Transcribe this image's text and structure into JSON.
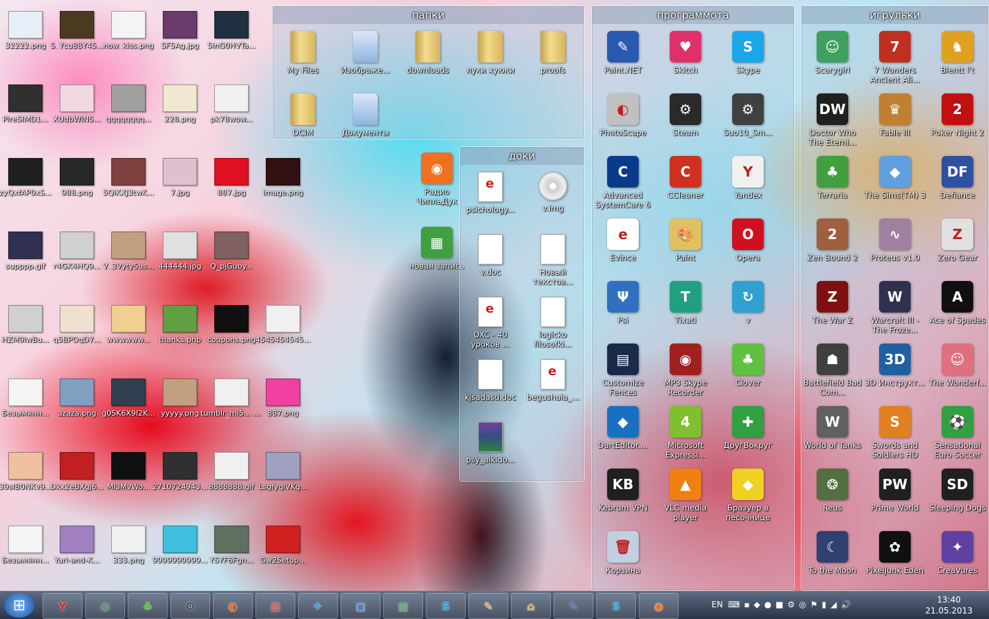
{
  "desktop_icons": [
    {
      "label": "32222.png",
      "color": "#e8eef8"
    },
    {
      "label": "S_Ycu88Y45...",
      "color": "#4a3a20"
    },
    {
      "label": "now_kiss.png",
      "color": "#f4f4f4"
    },
    {
      "label": "SF5Ag.jpg",
      "color": "#6a3a6a"
    },
    {
      "label": "5inG0HVTa...",
      "color": "#203040"
    },
    {
      "label": "PireSIMD1...",
      "color": "#303030"
    },
    {
      "label": "XUdbWIN5...",
      "color": "#f0d8e0"
    },
    {
      "label": "qqqqqqqq...",
      "color": "#a0a0a0"
    },
    {
      "label": "228.png",
      "color": "#f0e8d0"
    },
    {
      "label": "pk78wow...",
      "color": "#f0f0f0"
    },
    {
      "label": "zyQxfAP0xS...",
      "color": "#202020"
    },
    {
      "label": "988.png",
      "color": "#282828"
    },
    {
      "label": "5QiKXJ3twK...",
      "color": "#804040"
    },
    {
      "label": "7.jpg",
      "color": "#e0c0d0"
    },
    {
      "label": "887.jpg",
      "color": "#e01020"
    },
    {
      "label": "image.png",
      "color": "#301010"
    },
    {
      "label": "supppp.gif",
      "color": "#303050"
    },
    {
      "label": "r4GK4HQ9...",
      "color": "#d0d0d0"
    },
    {
      "label": "V_3Vyty5us...",
      "color": "#c0a080"
    },
    {
      "label": "444444.jpg",
      "color": "#e0e0e0"
    },
    {
      "label": "Q_pjGuby...",
      "color": "#806060"
    },
    {
      "label": "HZM9lwBu...",
      "color": "#d0d0d0"
    },
    {
      "label": "q5BPOqD7...",
      "color": "#f0e0d0"
    },
    {
      "label": "wwwwww...",
      "color": "#f0d090"
    },
    {
      "label": "thanks.php",
      "color": "#60a040"
    },
    {
      "label": "coupons.png",
      "color": "#101010"
    },
    {
      "label": "4545454545...",
      "color": "#f0f0f0"
    },
    {
      "label": "Безымянн...",
      "color": "#f4f4f4"
    },
    {
      "label": "azaza.png",
      "color": "#80a0c0"
    },
    {
      "label": "g0SK6X9I2K...",
      "color": "#304050"
    },
    {
      "label": "yyyyy.png",
      "color": "#c0a080"
    },
    {
      "label": "tumblr_mi5... (1).jpg",
      "color": "#f0f0f0"
    },
    {
      "label": "887.png",
      "color": "#f040a0"
    },
    {
      "label": "39sIB0NKv9...",
      "color": "#f0c0a0"
    },
    {
      "label": "Dkx2eBXgj6...",
      "color": "#c02020"
    },
    {
      "label": "Mi3MvWo...",
      "color": "#101010"
    },
    {
      "label": "2710724943...",
      "color": "#303030"
    },
    {
      "label": "8888888.gif",
      "color": "#f0f0f0"
    },
    {
      "label": "LsgfyqiVKg...",
      "color": "#a0a0c0"
    },
    {
      "label": "Безымянн...",
      "color": "#f4f4f4"
    },
    {
      "label": "Yuri-and-K...",
      "color": "#a080c0"
    },
    {
      "label": "333.png",
      "color": "#f0f0f0"
    },
    {
      "label": "9999999999...",
      "color": "#40c0e0"
    },
    {
      "label": "YSYF6Fgn...",
      "color": "#607060"
    },
    {
      "label": "Gw2Setup...",
      "color": "#d02020"
    }
  ],
  "loose_icons": [
    {
      "label": "Радио ЧипльДук",
      "color": "#f07020"
    },
    {
      "label": "новая запись",
      "color": "#40a040"
    }
  ],
  "fences": {
    "folders": {
      "title": "папки",
      "items": [
        {
          "label": "My Files",
          "kind": "folder"
        },
        {
          "label": "Изображе...",
          "kind": "pc"
        },
        {
          "label": "downloads",
          "kind": "folder"
        },
        {
          "label": "луки хуюки",
          "kind": "folder"
        },
        {
          "label": "proofs",
          "kind": "folder"
        },
        {
          "label": "DCIM",
          "kind": "folder"
        },
        {
          "label": "Документы",
          "kind": "docs"
        }
      ]
    },
    "docs": {
      "title": "доки",
      "items": [
        {
          "label": "psichology...",
          "kind": "evince"
        },
        {
          "label": "v.img",
          "kind": "disc"
        },
        {
          "label": "v.doc",
          "kind": "blank"
        },
        {
          "label": "Новый текстов...",
          "kind": "text"
        },
        {
          "label": "OXC - 40 уроков ...",
          "kind": "evince"
        },
        {
          "label": "logicko filosofki...",
          "kind": "blank"
        },
        {
          "label": "kjsadasd.doc",
          "kind": "blank"
        },
        {
          "label": "begushaia_...",
          "kind": "evince"
        },
        {
          "label": "psy_aikido...",
          "kind": "rar"
        }
      ]
    },
    "programs": {
      "title": "программота",
      "items": [
        {
          "label": "Paint.NET",
          "color": "#2a5ab0",
          "glyph": "✎"
        },
        {
          "label": "Skitch",
          "color": "#e0306a",
          "glyph": "♥"
        },
        {
          "label": "Skype",
          "color": "#1aa6e8",
          "glyph": "S"
        },
        {
          "label": "PhotoScape",
          "color": "#c0c0c0",
          "glyph": "◐"
        },
        {
          "label": "Steam",
          "color": "#2a2a2a",
          "glyph": "⚙"
        },
        {
          "label": "Suo10_Sm...",
          "color": "#404040",
          "glyph": "⚙"
        },
        {
          "label": "Advanced SystemCare 6",
          "color": "#0a3a8a",
          "glyph": "C"
        },
        {
          "label": "CCleaner",
          "color": "#d03020",
          "glyph": "C"
        },
        {
          "label": "Yandex",
          "color": "#f0f0f0",
          "glyph": "Y"
        },
        {
          "label": "Evince",
          "color": "#ffffff",
          "glyph": "e"
        },
        {
          "label": "Paint",
          "color": "#e0c060",
          "glyph": "🎨"
        },
        {
          "label": "Opera",
          "color": "#d01020",
          "glyph": "O"
        },
        {
          "label": "Psi",
          "color": "#3070c0",
          "glyph": "Ψ"
        },
        {
          "label": "Tixati",
          "color": "#20a080",
          "glyph": "T"
        },
        {
          "label": "v",
          "color": "#30a0d0",
          "glyph": "↻"
        },
        {
          "label": "Customize Fences",
          "color": "#1a2a4a",
          "glyph": "▤"
        },
        {
          "label": "MP3 Skype Recorder",
          "color": "#a02020",
          "glyph": "◉"
        },
        {
          "label": "Clover",
          "color": "#60c040",
          "glyph": "♣"
        },
        {
          "label": "DartEditor....",
          "color": "#1a70c0",
          "glyph": "◆"
        },
        {
          "label": "Microsoft Expressi...",
          "color": "#80c030",
          "glyph": "4"
        },
        {
          "label": "ДругВокруг",
          "color": "#30a040",
          "glyph": "✚"
        },
        {
          "label": "Kebrum VPN",
          "color": "#202020",
          "glyph": "KB"
        },
        {
          "label": "VLC media player",
          "color": "#f08010",
          "glyph": "▲"
        },
        {
          "label": "Бразуер в песочнице",
          "color": "#f0d020",
          "glyph": "◆"
        },
        {
          "label": "Корзина",
          "color": "#c0d0e0",
          "glyph": "🗑"
        }
      ]
    },
    "games": {
      "title": "игрульки",
      "items": [
        {
          "label": "Scarygirl",
          "color": "#40a060",
          "glyph": "☺"
        },
        {
          "label": "7 Wonders Ancient Ali...",
          "color": "#c03020",
          "glyph": "7"
        },
        {
          "label": "Bientt l't",
          "color": "#e0a020",
          "glyph": "♞"
        },
        {
          "label": "Doctor Who The Eterni...",
          "color": "#202020",
          "glyph": "DW"
        },
        {
          "label": "Fable III",
          "color": "#c08030",
          "glyph": "♛"
        },
        {
          "label": "Poker Night 2",
          "color": "#c01010",
          "glyph": "2"
        },
        {
          "label": "Terraria",
          "color": "#40a040",
          "glyph": "♣"
        },
        {
          "label": "The Sims(TM) 3",
          "color": "#60a0e0",
          "glyph": "◆"
        },
        {
          "label": "Defiance",
          "color": "#3050a0",
          "glyph": "DF"
        },
        {
          "label": "Zen Bound 2",
          "color": "#a06040",
          "glyph": "2"
        },
        {
          "label": "Proteus v1.0",
          "color": "#a080a0",
          "glyph": "∿"
        },
        {
          "label": "Zero Gear",
          "color": "#e0e0e0",
          "glyph": "Z"
        },
        {
          "label": "The War Z",
          "color": "#801010",
          "glyph": "Z"
        },
        {
          "label": "Warcraft III - The Froze...",
          "color": "#303050",
          "glyph": "W"
        },
        {
          "label": "Ace of Spades",
          "color": "#101010",
          "glyph": "A"
        },
        {
          "label": "Battlefield Bad Com...",
          "color": "#404040",
          "glyph": "☗"
        },
        {
          "label": "3D Инструкт...",
          "color": "#2060a0",
          "glyph": "3D"
        },
        {
          "label": "The Wonderf...",
          "color": "#e07080",
          "glyph": "☺"
        },
        {
          "label": "World of Tanks",
          "color": "#606060",
          "glyph": "W"
        },
        {
          "label": "Swords and Soldiers HD",
          "color": "#e08020",
          "glyph": "S"
        },
        {
          "label": "Sensational Euro Soccer",
          "color": "#30a040",
          "glyph": "⚽"
        },
        {
          "label": "Reus",
          "color": "#507040",
          "glyph": "❂"
        },
        {
          "label": "Prime World",
          "color": "#202020",
          "glyph": "PW"
        },
        {
          "label": "Sleeping Dogs",
          "color": "#202020",
          "glyph": "SD"
        },
        {
          "label": "To the Moon",
          "color": "#304070",
          "glyph": "☾"
        },
        {
          "label": "PixelJunk Eden",
          "color": "#101010",
          "glyph": "✿"
        },
        {
          "label": "CreaVures",
          "color": "#6040a0",
          "glyph": "✦"
        }
      ]
    }
  },
  "taskbar": {
    "start_glyph": "⊞",
    "buttons": [
      {
        "name": "yandex",
        "glyph": "Y",
        "color": "#e02020"
      },
      {
        "name": "chrome",
        "glyph": "◎",
        "color": "#30a040"
      },
      {
        "name": "clover",
        "glyph": "♣",
        "color": "#60c040"
      },
      {
        "name": "steam",
        "glyph": "⚙",
        "color": "#303030"
      },
      {
        "name": "photoscape",
        "glyph": "◐",
        "color": "#f07020"
      },
      {
        "name": "grid-app",
        "glyph": "▦",
        "color": "#c04040"
      },
      {
        "name": "twitter",
        "glyph": "✈",
        "color": "#30a0e0"
      },
      {
        "name": "image-viewer",
        "glyph": "▣",
        "color": "#5080c0"
      },
      {
        "name": "task-manager",
        "glyph": "▤",
        "color": "#40a060"
      },
      {
        "name": "skype",
        "glyph": "S",
        "color": "#1aa6e8"
      },
      {
        "name": "paint",
        "glyph": "✎",
        "color": "#e0c060"
      },
      {
        "name": "fences-manager",
        "glyph": "⌂",
        "color": "#e0c040"
      },
      {
        "name": "paintnet",
        "glyph": "✎",
        "color": "#2a5ab0"
      },
      {
        "name": "skype-2",
        "glyph": "S",
        "color": "#1aa6e8"
      },
      {
        "name": "radio",
        "glyph": "◉",
        "color": "#f07020"
      }
    ],
    "lang": "EN",
    "time": "13:40",
    "date": "21.05.2013"
  }
}
